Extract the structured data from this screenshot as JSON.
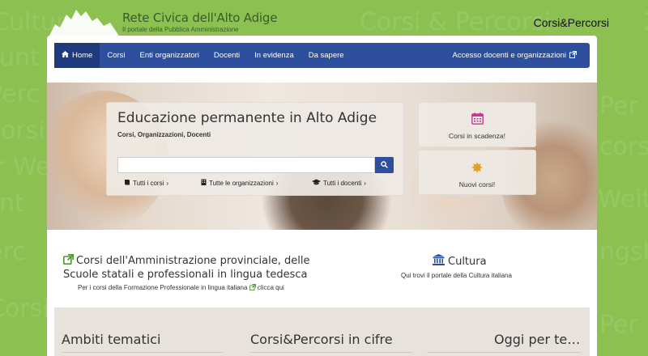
{
  "background_words": "Corsi&Percorsi Zentrum Weiterbildung",
  "header": {
    "logo_title": "Rete Civica dell'Alto Adige",
    "logo_subtitle": "Il portale della Pubblica Amministrazione",
    "brand": "Corsi&Percorsi"
  },
  "navbar": {
    "items": [
      {
        "label": "Home",
        "icon": "home-icon",
        "active": true
      },
      {
        "label": "Corsi"
      },
      {
        "label": "Enti organizzatori"
      },
      {
        "label": "Docenti"
      },
      {
        "label": "In evidenza"
      },
      {
        "label": "Da sapere"
      }
    ],
    "right_label": "Accesso docenti e organizzazioni"
  },
  "hero": {
    "title": "Educazione permanente in Alto Adige",
    "subtitle": "Corsi, Organizzazioni, Docenti",
    "search_value": "",
    "links": [
      {
        "label": "Tutti i corsi",
        "icon": "book-icon"
      },
      {
        "label": "Tutte le organizzazioni",
        "icon": "building-icon"
      },
      {
        "label": "Tutti i docenti",
        "icon": "graduation-cap-icon"
      }
    ],
    "box_expiring": "Corsi in scadenza!",
    "box_new": "Nuovi corsi!"
  },
  "lower": {
    "left_title": "Corsi dell'Amministrazione provinciale, delle Scuole statali e professionali in lingua tedesca",
    "left_note_prefix": "Per i corsi della Formazione Professionale in lingua italiana",
    "left_note_link": "clicca qui",
    "culture_title": "Cultura",
    "culture_sub": "Qui trovi il portale della Cultura italiana"
  },
  "band": {
    "col1": "Ambiti tematici",
    "col2": "Corsi&Percorsi in cifre",
    "col3": "Oggi per te…"
  },
  "colors": {
    "green_bg": "#8cc152",
    "nav_blue": "#2d4f9e",
    "calendar_pink": "#c0398a",
    "star_orange": "#e1a020"
  }
}
